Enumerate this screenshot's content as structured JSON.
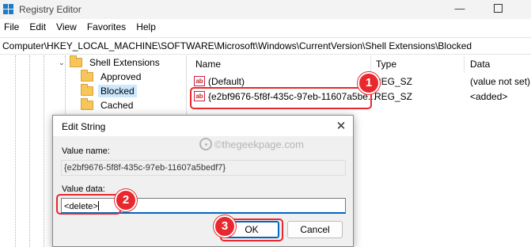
{
  "window": {
    "title": "Registry Editor",
    "minimize_glyph": "—",
    "accent_color": "#1f7ac5"
  },
  "menu": [
    "File",
    "Edit",
    "View",
    "Favorites",
    "Help"
  ],
  "address": {
    "path": "Computer\\HKEY_LOCAL_MACHINE\\SOFTWARE\\Microsoft\\Windows\\CurrentVersion\\Shell Extensions\\Blocked"
  },
  "tree": {
    "expanded_chevron": "⌄",
    "nodes": [
      {
        "label": "Shell Extensions",
        "icon": "folder-icon",
        "expanded": true
      },
      {
        "label": "Approved",
        "icon": "folder-icon"
      },
      {
        "label": "Blocked",
        "icon": "folder-icon",
        "selected": true
      },
      {
        "label": "Cached",
        "icon": "folder-icon"
      }
    ]
  },
  "values_list": {
    "columns": {
      "name": "Name",
      "type": "Type",
      "data": "Data"
    },
    "rows": [
      {
        "icon": "ab",
        "name": "(Default)",
        "type": "REG_SZ",
        "data": "(value not set)"
      },
      {
        "icon": "ab",
        "name": "{e2bf9676-5f8f-435c-97eb-11607a5be...",
        "type": "REG_SZ",
        "data": "<added>"
      }
    ]
  },
  "dialog": {
    "title": "Edit String",
    "close_glyph": "✕",
    "value_name_label": "Value name:",
    "value_name": "{e2bf9676-5f8f-435c-97eb-11607a5bedf7}",
    "value_data_label": "Value data:",
    "value_data": "<delete>",
    "ok_label": "OK",
    "cancel_label": "Cancel"
  },
  "watermark": "©thegeekpage.com",
  "annotations": {
    "color": "#e8282d",
    "steps": [
      "1",
      "2",
      "3"
    ]
  }
}
